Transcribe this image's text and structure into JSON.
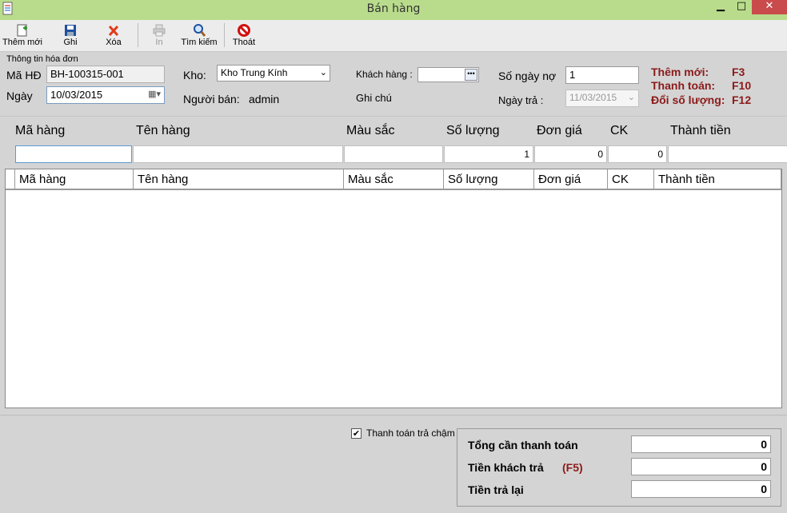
{
  "window": {
    "title": "Bán hàng",
    "min": "▁",
    "max": "□",
    "close": "✕"
  },
  "toolbar": {
    "add": "Thêm mới",
    "save": "Ghi",
    "delete": "Xóa",
    "print": "In",
    "search": "Tìm kiếm",
    "exit": "Thoát"
  },
  "invoice": {
    "group_label": "Thông tin hóa đơn",
    "code_label": "Mã HĐ",
    "code_value": "BH-100315-001",
    "date_label": "Ngày",
    "date_value": "10/03/2015",
    "warehouse_label": "Kho:",
    "warehouse_value": "Kho Trung Kính",
    "seller_label": "Người bán:",
    "seller_value": "admin",
    "customer_label": "Khách hàng :",
    "customer_value": "",
    "note_label": "Ghi chú",
    "debt_days_label": "Số ngày nợ",
    "debt_days_value": "1",
    "pay_date_label": "Ngày trả :",
    "pay_date_value": "11/03/2015"
  },
  "shortcuts": [
    {
      "label": "Thêm mới:",
      "key": "F3"
    },
    {
      "label": "Thanh toán:",
      "key": "F10"
    },
    {
      "label": "Đổi số lượng:",
      "key": "F12"
    }
  ],
  "entry": {
    "headers": [
      "Mã hàng",
      "Tên hàng",
      "Màu sắc",
      "Số lượng",
      "Đơn giá",
      "CK",
      "Thành tiền"
    ],
    "values": {
      "code": "",
      "name": "",
      "color": "",
      "qty": "1",
      "price": "0",
      "discount": "0",
      "total": ""
    }
  },
  "grid": {
    "columns": [
      "Mã hàng",
      "Tên hàng",
      "Màu sắc",
      "Số lượng",
      "Đơn giá",
      "CK",
      "Thành tiền"
    ]
  },
  "payment": {
    "deferred_label": "Thanh toán trả chậm",
    "deferred_checked": true,
    "total_label": "Tổng cần thanh toán",
    "total_value": "0",
    "paid_label": "Tiền khách trả",
    "paid_key": "(F5)",
    "paid_value": "0",
    "change_label": "Tiền trả lại",
    "change_value": "0"
  },
  "colors": {
    "titlebar": "#b9dc8c",
    "accent_red": "#8b1a1a",
    "close": "#c94b4b"
  }
}
